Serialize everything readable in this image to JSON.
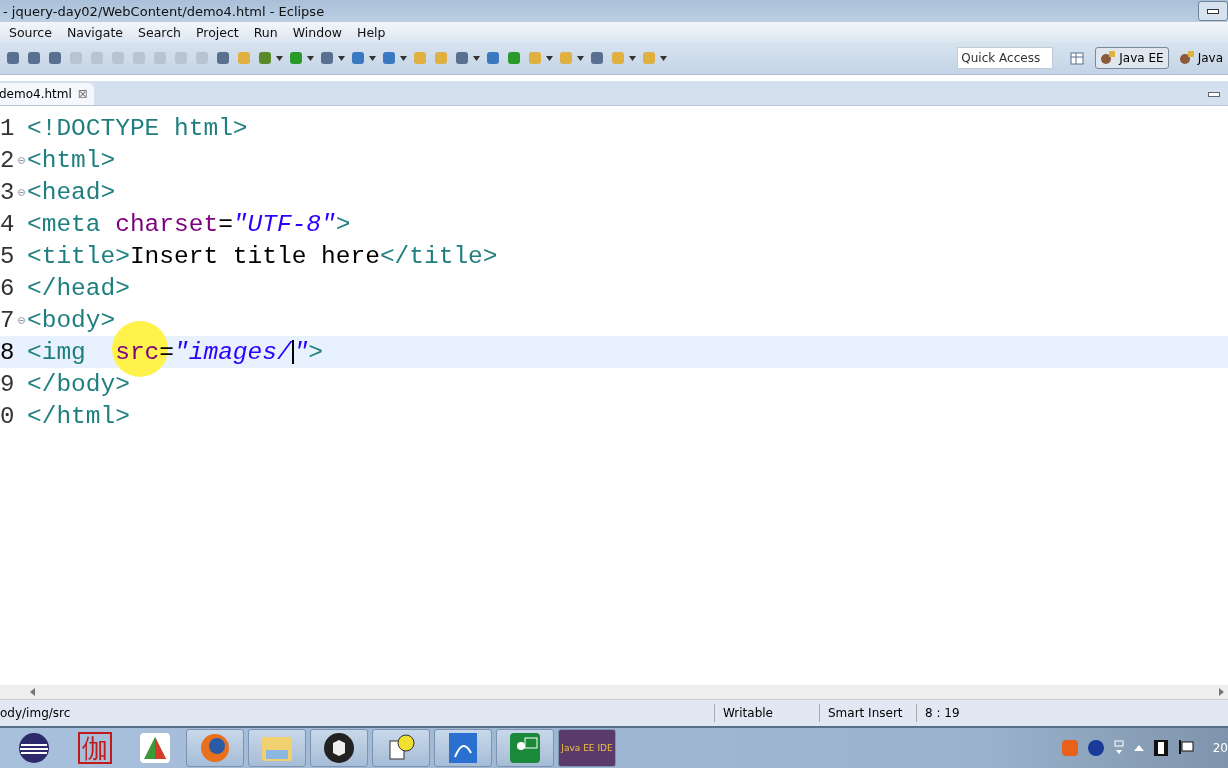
{
  "window": {
    "title": "- jquery-day02/WebContent/demo4.html - Eclipse"
  },
  "menu": [
    "Source",
    "Navigate",
    "Search",
    "Project",
    "Run",
    "Window",
    "Help"
  ],
  "quick_access": {
    "placeholder": "Quick Access"
  },
  "perspectives": [
    {
      "label": "Java EE",
      "selected": true
    },
    {
      "label": "Java",
      "selected": false
    }
  ],
  "editor_tab": {
    "label": "demo4.html",
    "close": "⊠"
  },
  "code_lines": [
    {
      "number": "1",
      "fold": false,
      "current": false,
      "tokens": [
        {
          "kind": "tag",
          "text": "<!DOCTYPE html>"
        }
      ]
    },
    {
      "number": "2",
      "fold": true,
      "current": false,
      "tokens": [
        {
          "kind": "tag",
          "text": "<html>"
        }
      ]
    },
    {
      "number": "3",
      "fold": true,
      "current": false,
      "tokens": [
        {
          "kind": "tag",
          "text": "<head>"
        }
      ]
    },
    {
      "number": "4",
      "fold": false,
      "current": false,
      "tokens": [
        {
          "kind": "tag",
          "text": "<meta "
        },
        {
          "kind": "attr",
          "text": "charset"
        },
        {
          "kind": "plain",
          "text": "="
        },
        {
          "kind": "value",
          "text": "\"UTF-8\""
        },
        {
          "kind": "tag",
          "text": ">"
        }
      ]
    },
    {
      "number": "5",
      "fold": false,
      "current": false,
      "tokens": [
        {
          "kind": "tag",
          "text": "<title>"
        },
        {
          "kind": "plain",
          "text": "Insert title here"
        },
        {
          "kind": "tag",
          "text": "</title>"
        }
      ]
    },
    {
      "number": "6",
      "fold": false,
      "current": false,
      "tokens": [
        {
          "kind": "tag",
          "text": "</head>"
        }
      ]
    },
    {
      "number": "7",
      "fold": true,
      "current": false,
      "tokens": [
        {
          "kind": "tag",
          "text": "<body>"
        }
      ]
    },
    {
      "number": "8",
      "fold": false,
      "current": true,
      "tokens": [
        {
          "kind": "tag",
          "text": "<img  "
        },
        {
          "kind": "attr",
          "text": "src"
        },
        {
          "kind": "plain",
          "text": "="
        },
        {
          "kind": "value",
          "text": "\"images/"
        },
        {
          "kind": "caret"
        },
        {
          "kind": "value",
          "text": "\""
        },
        {
          "kind": "tag",
          "text": ">"
        }
      ]
    },
    {
      "number": "9",
      "fold": false,
      "current": false,
      "tokens": [
        {
          "kind": "tag",
          "text": "</body>"
        }
      ]
    },
    {
      "number": "0",
      "fold": false,
      "current": false,
      "tokens": [
        {
          "kind": "tag",
          "text": "</html>"
        }
      ]
    }
  ],
  "status_bar": {
    "path": "ody/img/src",
    "mode": "Writable",
    "insert": "Smart Insert",
    "position": "8 : 19"
  },
  "taskbar": {
    "char_icon": "伽",
    "ide_icon": "Java EE IDE",
    "clock": "20"
  }
}
